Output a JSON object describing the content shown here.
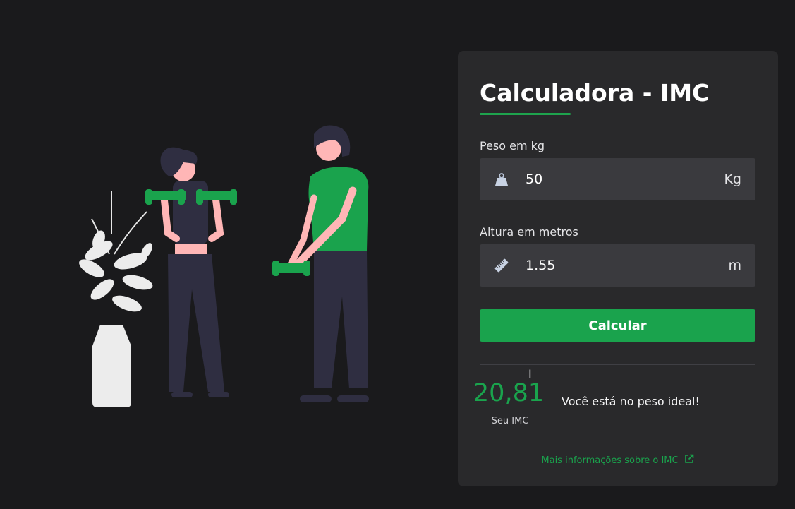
{
  "card": {
    "title": "Calculadora - IMC",
    "weight": {
      "label": "Peso em kg",
      "value": "50",
      "unit": "Kg",
      "icon": "weight-icon"
    },
    "height": {
      "label": "Altura em metros",
      "value": "1.55",
      "unit": "m",
      "icon": "ruler-icon"
    },
    "button_label": "Calcular",
    "result": {
      "value": "20,81",
      "caption": "Seu IMC",
      "message": "Você está no peso ideal!"
    },
    "more_info": {
      "label": "Mais informações sobre o IMC",
      "icon": "external-link-icon"
    }
  },
  "colors": {
    "background": "#1a1a1c",
    "card": "#29292b",
    "input": "#3a3a3e",
    "accent": "#1aa34d"
  },
  "illustration": {
    "icon": "fitness-people-illustration"
  }
}
